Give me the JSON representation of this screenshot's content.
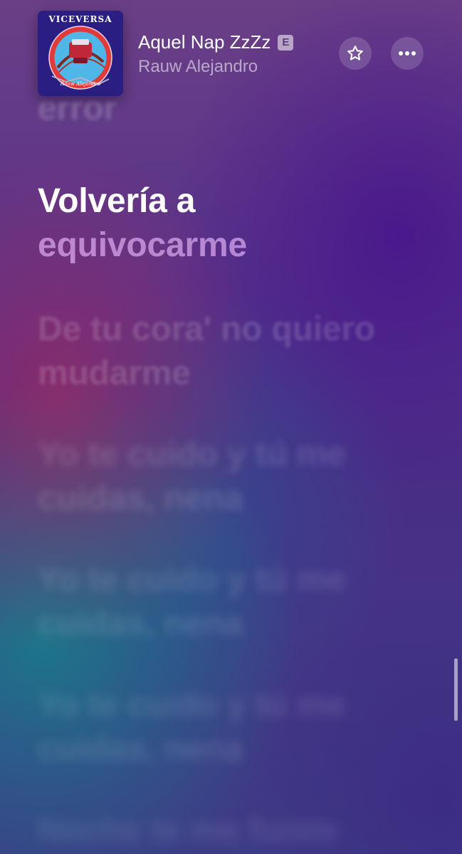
{
  "now_playing": {
    "title": "Aquel Nap ZzZz",
    "explicit_badge": "E",
    "artist": "Rauw Alejandro",
    "artwork": {
      "text": "VICEVERSA",
      "signature": "Rauw Alejandro",
      "colors": {
        "background": "#2a1e82",
        "ring": "#e03a3a",
        "sky": "#4fb6e8"
      }
    }
  },
  "actions": {
    "favorite_icon": "star-icon",
    "more_icon": "ellipsis-icon"
  },
  "lyrics": {
    "previous": "error",
    "current": {
      "sung": "Volvería a",
      "unsung": "equivocarme"
    },
    "upcoming": [
      {
        "line1": "De tu cora' no quiero",
        "line2": "mudarme"
      },
      {
        "line1": "Yo te cuido y tú me",
        "line2": "cuidas, nena"
      },
      {
        "line1": "Yo te cuido y tú me",
        "line2": "cuidas, nena"
      },
      {
        "line1": "Yo te cuido y tú me",
        "line2": "cuidas, nena"
      },
      {
        "line1": "Noche te me fuiste",
        "line2": ""
      }
    ]
  },
  "colors": {
    "lyric_active": "#ffffff",
    "lyric_pending": "#d7a5eb",
    "background_purple": "#55328a",
    "background_teal": "#14828c"
  }
}
